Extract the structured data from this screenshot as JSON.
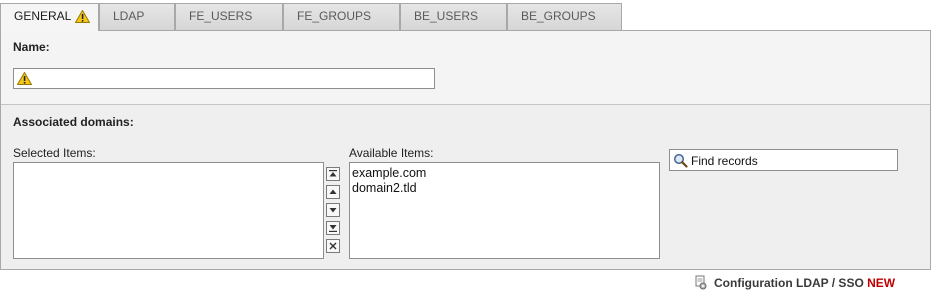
{
  "tabs": [
    {
      "label": "GENERAL",
      "active": true,
      "warning": true
    },
    {
      "label": "LDAP"
    },
    {
      "label": "FE_USERS"
    },
    {
      "label": "FE_GROUPS"
    },
    {
      "label": "BE_USERS"
    },
    {
      "label": "BE_GROUPS"
    }
  ],
  "general": {
    "name_label": "Name:",
    "name_value": "",
    "associated_label": "Associated domains:",
    "selected_label": "Selected Items:",
    "available_label": "Available Items:",
    "available_items": [
      "example.com",
      "domain2.tld"
    ],
    "find_value": "Find records"
  },
  "footer": {
    "title": "Configuration LDAP / SSO",
    "badge": "NEW"
  },
  "icons": {
    "warning": "warning-icon",
    "move_top": "move-to-top-icon",
    "move_up": "move-up-icon",
    "move_down": "move-down-icon",
    "move_bottom": "move-to-bottom-icon",
    "remove": "remove-icon",
    "search": "magnifier-icon",
    "config": "configuration-icon"
  },
  "colors": {
    "warning_fill": "#f5c518",
    "new_badge": "#c00000"
  }
}
